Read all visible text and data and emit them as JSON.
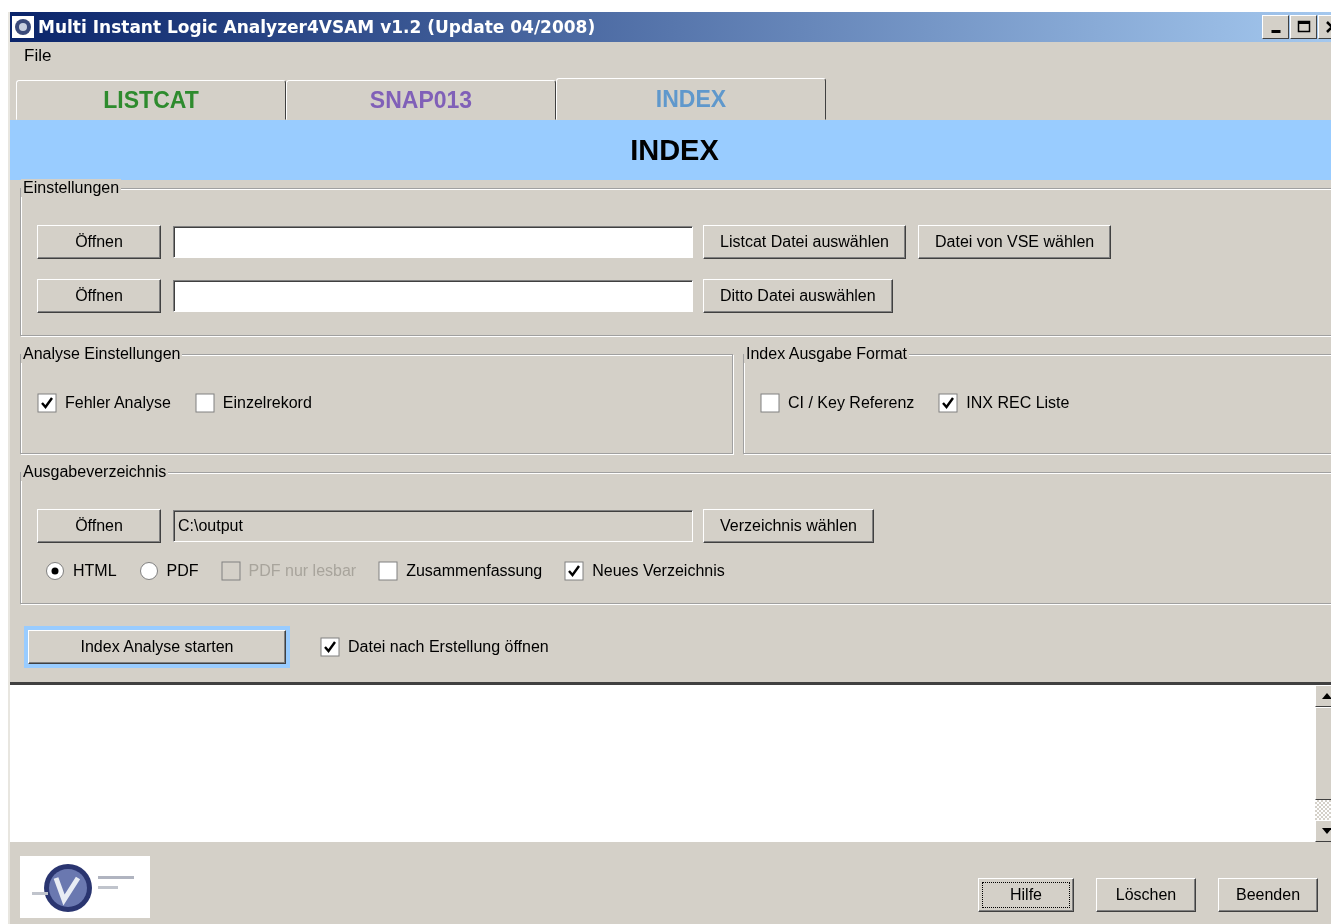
{
  "window": {
    "title": "Multi Instant Logic Analyzer4VSAM v1.2 (Update 04/2008)"
  },
  "menu": [
    "File"
  ],
  "tabs": [
    {
      "label": "LISTCAT",
      "selected": false,
      "color": "#2e8b2e"
    },
    {
      "label": "SNAP013",
      "selected": false,
      "color": "#8060b8"
    },
    {
      "label": "INDEX",
      "selected": true,
      "color": "#5f98cc"
    }
  ],
  "banner": "INDEX",
  "einstellungen": {
    "title": "Einstellungen",
    "rows": [
      {
        "open_button": "Öffnen",
        "buttons": [
          "Listcat Datei auswählen",
          "Datei von VSE wählen"
        ]
      },
      {
        "open_button": "Öffnen",
        "buttons": [
          "Ditto Datei auswählen"
        ]
      }
    ]
  },
  "analyse": {
    "title": "Analyse Einstellungen",
    "options": [
      {
        "kind": "checkbox",
        "label": "Fehler Analyse",
        "checked": true,
        "disabled": false
      },
      {
        "kind": "checkbox",
        "label": "Einzelrekord",
        "checked": false,
        "disabled": false
      }
    ]
  },
  "format": {
    "title": "Index Ausgabe Format",
    "options": [
      {
        "kind": "checkbox",
        "label": "CI / Key Referenz",
        "checked": false,
        "disabled": false
      },
      {
        "kind": "checkbox",
        "label": "INX REC Liste",
        "checked": true,
        "disabled": false
      }
    ]
  },
  "ausgabe": {
    "title": "Ausgabeverzeichnis",
    "open_button": "Öffnen",
    "path": "C:\\output",
    "choose_button": "Verzeichnis wählen",
    "options": [
      {
        "kind": "radio",
        "label": "HTML",
        "selected": true,
        "disabled": false
      },
      {
        "kind": "radio",
        "label": "PDF",
        "selected": false,
        "disabled": false
      },
      {
        "kind": "checkbox",
        "label": "PDF nur lesbar",
        "checked": false,
        "disabled": true
      },
      {
        "kind": "checkbox",
        "label": "Zusammenfassung",
        "checked": false,
        "disabled": false
      },
      {
        "kind": "checkbox",
        "label": "Neues Verzeichnis",
        "checked": true,
        "disabled": false
      }
    ]
  },
  "start": {
    "button": "Index Analyse starten",
    "focused": true,
    "option": {
      "kind": "checkbox",
      "label": "Datei nach Erstellung öffnen",
      "checked": true,
      "disabled": false
    }
  },
  "footer_buttons": [
    {
      "label": "Hilfe",
      "focused": true
    },
    {
      "label": "Löschen",
      "focused": false
    },
    {
      "label": "Beenden",
      "focused": false
    }
  ]
}
